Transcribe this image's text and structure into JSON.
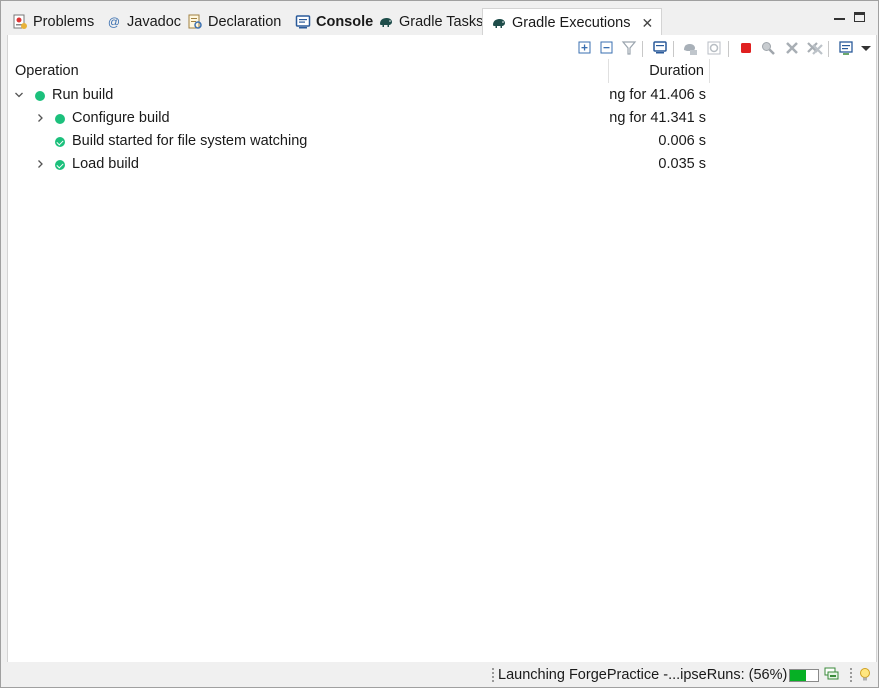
{
  "tabs": [
    {
      "label": "Problems",
      "icon": "problems-icon"
    },
    {
      "label": "Javadoc",
      "icon": "javadoc-icon"
    },
    {
      "label": "Declaration",
      "icon": "declaration-icon"
    },
    {
      "label": "Console",
      "icon": "console-icon"
    },
    {
      "label": "Gradle Tasks",
      "icon": "gradle-elephant-icon"
    },
    {
      "label": "Gradle Executions",
      "icon": "gradle-elephant-icon"
    }
  ],
  "toolbar": {
    "icons": [
      "expand-all-icon",
      "collapse-all-icon",
      "filter-icon",
      "console-link-icon",
      "rerun-icon",
      "rerun-failed-icon",
      "stop-icon",
      "search-icon",
      "remove-icon",
      "remove-all-icon",
      "history-icon",
      "view-menu-icon"
    ]
  },
  "table": {
    "col_operation": "Operation",
    "col_duration": "Duration",
    "rows": [
      {
        "name": "Run build",
        "duration": "ng for 41.406 s"
      },
      {
        "name": "Configure build",
        "duration": "ng for 41.341 s"
      },
      {
        "name": "Build started for file system watching",
        "duration": "0.006 s"
      },
      {
        "name": "Load build",
        "duration": "0.035 s"
      }
    ]
  },
  "status": {
    "text": "Launching ForgePractice -...ipseRuns: (56%)",
    "progress": 0.56
  },
  "colors": {
    "success_green": "#1cc07c",
    "progress_green": "#06b025",
    "stop_red": "#e02020"
  }
}
